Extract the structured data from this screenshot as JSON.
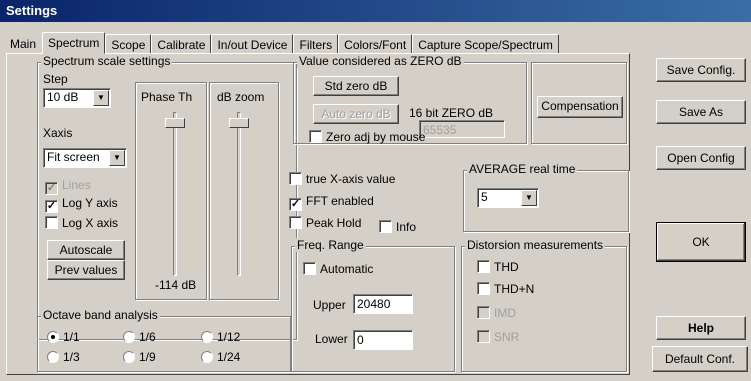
{
  "window": {
    "title": "Settings"
  },
  "tabs": [
    {
      "label": "Main"
    },
    {
      "label": "Spectrum"
    },
    {
      "label": "Scope"
    },
    {
      "label": "Calibrate"
    },
    {
      "label": "In/out Device"
    },
    {
      "label": "Filters"
    },
    {
      "label": "Colors/Font"
    },
    {
      "label": "Capture Scope/Spectrum"
    }
  ],
  "spectrum_scale": {
    "title": "Spectrum scale settings",
    "step_label": "Step",
    "step_value": "10 dB",
    "xaxis_label": "Xaxis",
    "xaxis_value": "Fit screen",
    "lines_label": "Lines",
    "lines_checked": true,
    "log_y_label": "Log Y axis",
    "log_y_checked": true,
    "log_x_label": "Log X axis",
    "log_x_checked": false,
    "autoscale_label": "Autoscale",
    "prev_values_label": "Prev values",
    "phase_th_label": "Phase Th",
    "phase_th_value": "-114 dB",
    "db_zoom_label": "dB zoom"
  },
  "zero_db": {
    "title": "Value considered as ZERO dB",
    "std_zero_label": "Std zero dB",
    "auto_zero_label": "Auto zero dB",
    "bit16_label": "16 bit ZERO dB",
    "bit16_value": "65535",
    "zero_adj_label": "Zero adj by mouse",
    "zero_adj_checked": false
  },
  "compensation_label": "Compensation",
  "options": {
    "true_x_label": "true X-axis value",
    "true_x_checked": false,
    "fft_enabled_label": "FFT enabled",
    "fft_enabled_checked": true,
    "peak_hold_label": "Peak Hold",
    "peak_hold_checked": false,
    "info_label": "Info",
    "info_checked": false
  },
  "average": {
    "title": "AVERAGE real time",
    "value": "5"
  },
  "freq_range": {
    "title": "Freq. Range",
    "automatic_label": "Automatic",
    "automatic_checked": false,
    "upper_label": "Upper",
    "upper_value": "20480",
    "lower_label": "Lower",
    "lower_value": "0"
  },
  "distortion": {
    "title": "Distorsion measurements",
    "thd_label": "THD",
    "thdn_label": "THD+N",
    "imd_label": "IMD",
    "snr_label": "SNR"
  },
  "octave": {
    "title": "Octave band analysis",
    "options": [
      "1/1",
      "1/6",
      "1/12",
      "1/3",
      "1/9",
      "1/24"
    ],
    "selected": "1/1"
  },
  "side_buttons": {
    "save_config": "Save Config.",
    "save_as": "Save As",
    "open_config": "Open Config",
    "ok": "OK",
    "help": "Help",
    "default_conf": "Default Conf."
  }
}
